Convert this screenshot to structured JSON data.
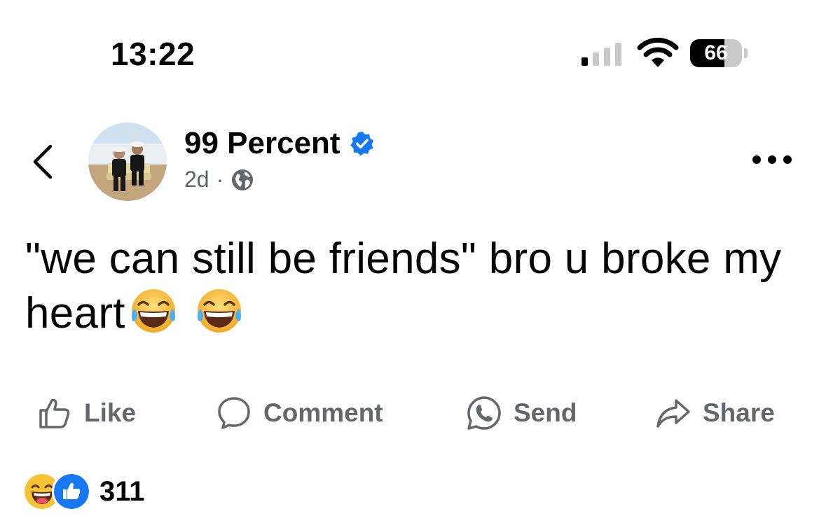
{
  "status_bar": {
    "time": "13:22",
    "battery": "66",
    "battery_level": 0.66,
    "signal_bars_active": 1,
    "signal_bars_total": 4
  },
  "header": {
    "back_icon": "chevron-left-icon",
    "page_name": "99 Percent",
    "verified_icon": "verified-badge-icon",
    "time_ago": "2d",
    "separator": "·",
    "audience_icon": "globe-icon",
    "more_icon": "more-horizontal-icon"
  },
  "post": {
    "text": "\"we can still be friends\" bro u broke my heart",
    "emoji_icon": "face-with-tears-of-joy-icon"
  },
  "actions": {
    "like": "Like",
    "comment": "Comment",
    "send": "Send",
    "share": "Share"
  },
  "reactions": {
    "icons": [
      "haha-reaction-icon",
      "like-reaction-icon"
    ],
    "count": "311"
  },
  "colors": {
    "text": "#050505",
    "muted": "#65676b",
    "verified_blue": "#1877f2",
    "like_blue": "#1877f2",
    "emoji_yellow": "#f7c233"
  }
}
